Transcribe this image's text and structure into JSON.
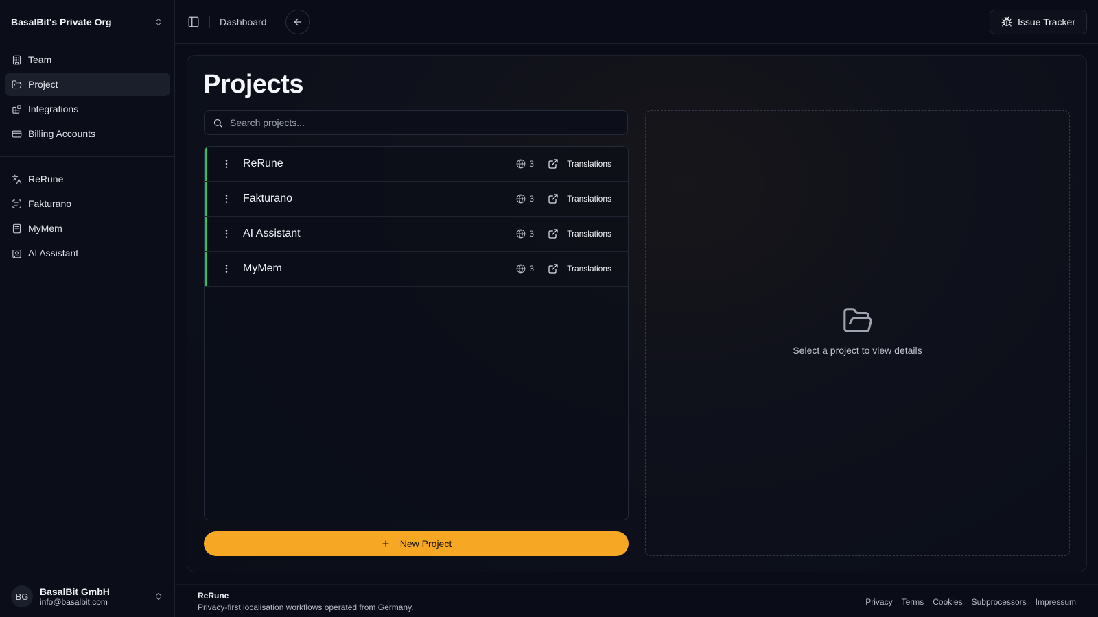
{
  "sidebar": {
    "org_name": "BasalBit's Private Org",
    "nav": [
      {
        "label": "Team",
        "icon": "building-icon"
      },
      {
        "label": "Project",
        "icon": "folder-open-icon",
        "active": true
      },
      {
        "label": "Integrations",
        "icon": "blocks-icon"
      },
      {
        "label": "Billing Accounts",
        "icon": "credit-card-icon"
      }
    ],
    "projects": [
      {
        "label": "ReRune",
        "icon": "languages-icon"
      },
      {
        "label": "Fakturano",
        "icon": "scan-text-icon"
      },
      {
        "label": "MyMem",
        "icon": "notebook-icon"
      },
      {
        "label": "AI Assistant",
        "icon": "contact-icon"
      }
    ],
    "user": {
      "initials": "BG",
      "name": "BasalBit GmbH",
      "email": "info@basalbit.com"
    }
  },
  "topbar": {
    "breadcrumb": "Dashboard",
    "issue_tracker_label": "Issue Tracker"
  },
  "main": {
    "title": "Projects",
    "search_placeholder": "Search projects...",
    "accent_color": "#22c55e",
    "projects": [
      {
        "name": "ReRune",
        "languages": "3",
        "action": "Translations"
      },
      {
        "name": "Fakturano",
        "languages": "3",
        "action": "Translations"
      },
      {
        "name": "AI Assistant",
        "languages": "3",
        "action": "Translations"
      },
      {
        "name": "MyMem",
        "languages": "3",
        "action": "Translations"
      }
    ],
    "new_project_label": "New Project",
    "new_project_color": "#f6a723",
    "empty_state_text": "Select a project to view details"
  },
  "footer": {
    "brand": "ReRune",
    "tagline": "Privacy-first localisation workflows operated from Germany.",
    "links": [
      "Privacy",
      "Terms",
      "Cookies",
      "Subprocessors",
      "Impressum"
    ]
  }
}
